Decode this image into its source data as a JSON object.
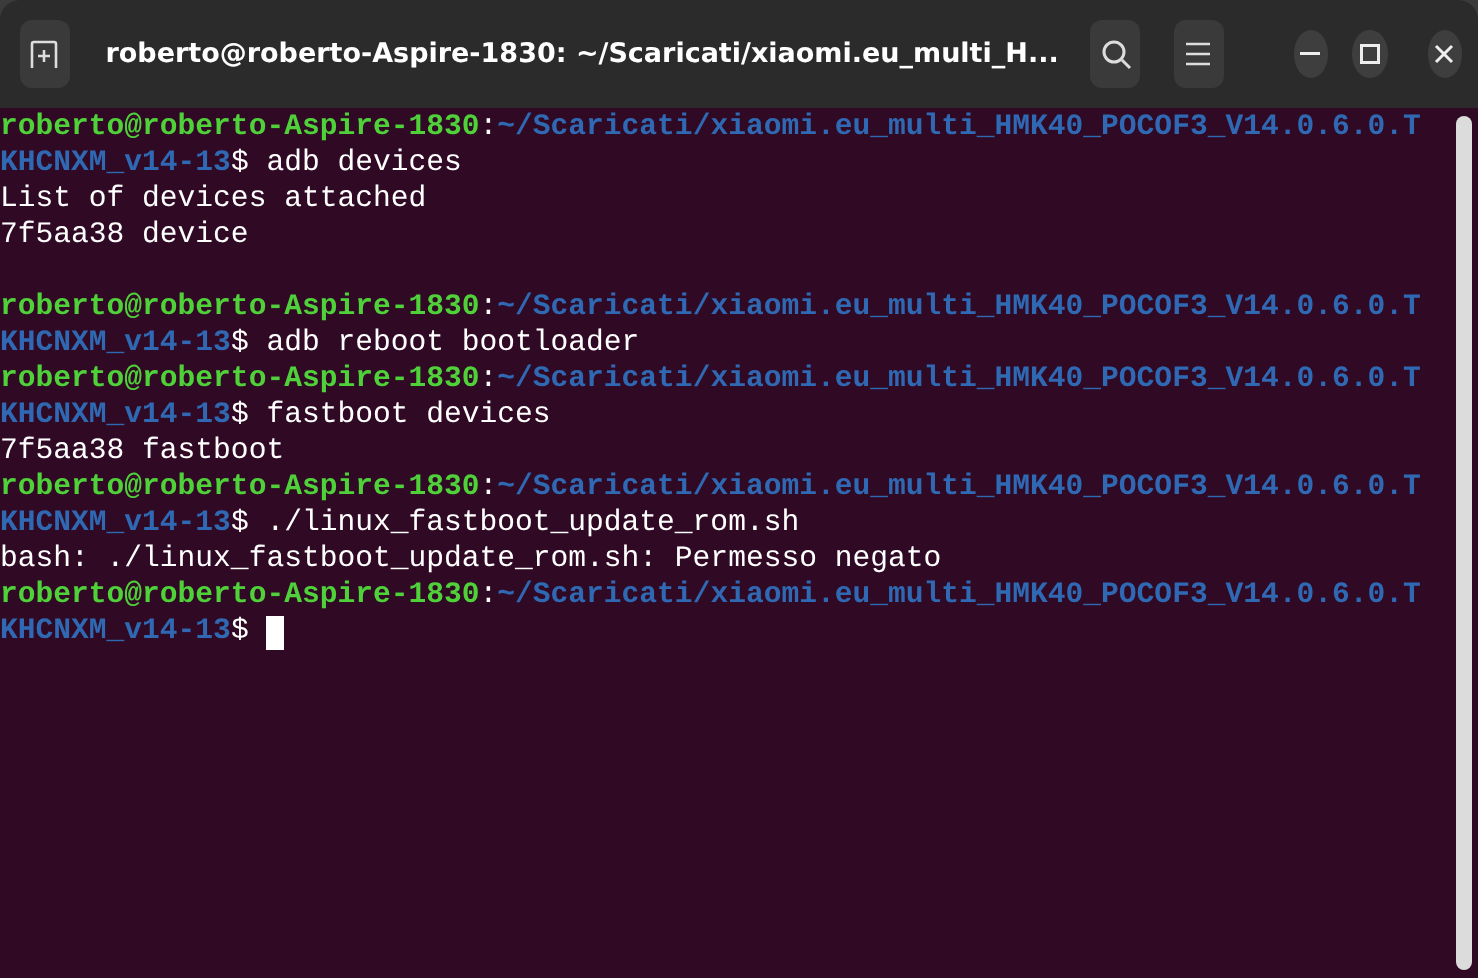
{
  "window": {
    "title": "roberto@roberto-Aspire-1830: ~/Scaricati/xiaomi.eu_multi_H..."
  },
  "terminal": {
    "lines": [
      {
        "kind": "text",
        "segments": [
          {
            "kind": "user",
            "text": "roberto@roberto-Aspire-1830"
          },
          {
            "kind": "plain",
            "text": ":"
          },
          {
            "kind": "path",
            "text": "~/Scaricati/xiaomi.eu_multi_HMK40_POCOF3_V14.0.6.0.T"
          }
        ]
      },
      {
        "kind": "text",
        "segments": [
          {
            "kind": "path",
            "text": "KHCNXM_v14-13"
          },
          {
            "kind": "plain",
            "text": "$ adb devices"
          }
        ]
      },
      {
        "kind": "text",
        "segments": [
          {
            "kind": "plain",
            "text": "List of devices attached"
          }
        ]
      },
      {
        "kind": "text",
        "segments": [
          {
            "kind": "plain",
            "text": "7f5aa38 device"
          }
        ]
      },
      {
        "kind": "blank"
      },
      {
        "kind": "text",
        "segments": [
          {
            "kind": "user",
            "text": "roberto@roberto-Aspire-1830"
          },
          {
            "kind": "plain",
            "text": ":"
          },
          {
            "kind": "path",
            "text": "~/Scaricati/xiaomi.eu_multi_HMK40_POCOF3_V14.0.6.0.T"
          }
        ]
      },
      {
        "kind": "text",
        "segments": [
          {
            "kind": "path",
            "text": "KHCNXM_v14-13"
          },
          {
            "kind": "plain",
            "text": "$ adb reboot bootloader"
          }
        ]
      },
      {
        "kind": "text",
        "segments": [
          {
            "kind": "user",
            "text": "roberto@roberto-Aspire-1830"
          },
          {
            "kind": "plain",
            "text": ":"
          },
          {
            "kind": "path",
            "text": "~/Scaricati/xiaomi.eu_multi_HMK40_POCOF3_V14.0.6.0.T"
          }
        ]
      },
      {
        "kind": "text",
        "segments": [
          {
            "kind": "path",
            "text": "KHCNXM_v14-13"
          },
          {
            "kind": "plain",
            "text": "$ fastboot devices"
          }
        ]
      },
      {
        "kind": "text",
        "segments": [
          {
            "kind": "plain",
            "text": "7f5aa38 fastboot"
          }
        ]
      },
      {
        "kind": "text",
        "segments": [
          {
            "kind": "user",
            "text": "roberto@roberto-Aspire-1830"
          },
          {
            "kind": "plain",
            "text": ":"
          },
          {
            "kind": "path",
            "text": "~/Scaricati/xiaomi.eu_multi_HMK40_POCOF3_V14.0.6.0.T"
          }
        ]
      },
      {
        "kind": "text",
        "segments": [
          {
            "kind": "path",
            "text": "KHCNXM_v14-13"
          },
          {
            "kind": "plain",
            "text": "$ ./linux_fastboot_update_rom.sh"
          }
        ]
      },
      {
        "kind": "text",
        "segments": [
          {
            "kind": "plain",
            "text": "bash: ./linux_fastboot_update_rom.sh: Permesso negato"
          }
        ]
      },
      {
        "kind": "text",
        "segments": [
          {
            "kind": "user",
            "text": "roberto@roberto-Aspire-1830"
          },
          {
            "kind": "plain",
            "text": ":"
          },
          {
            "kind": "path",
            "text": "~/Scaricati/xiaomi.eu_multi_HMK40_POCOF3_V14.0.6.0.T"
          }
        ]
      },
      {
        "kind": "text",
        "cursor": true,
        "segments": [
          {
            "kind": "path",
            "text": "KHCNXM_v14-13"
          },
          {
            "kind": "plain",
            "text": "$"
          }
        ]
      }
    ]
  }
}
